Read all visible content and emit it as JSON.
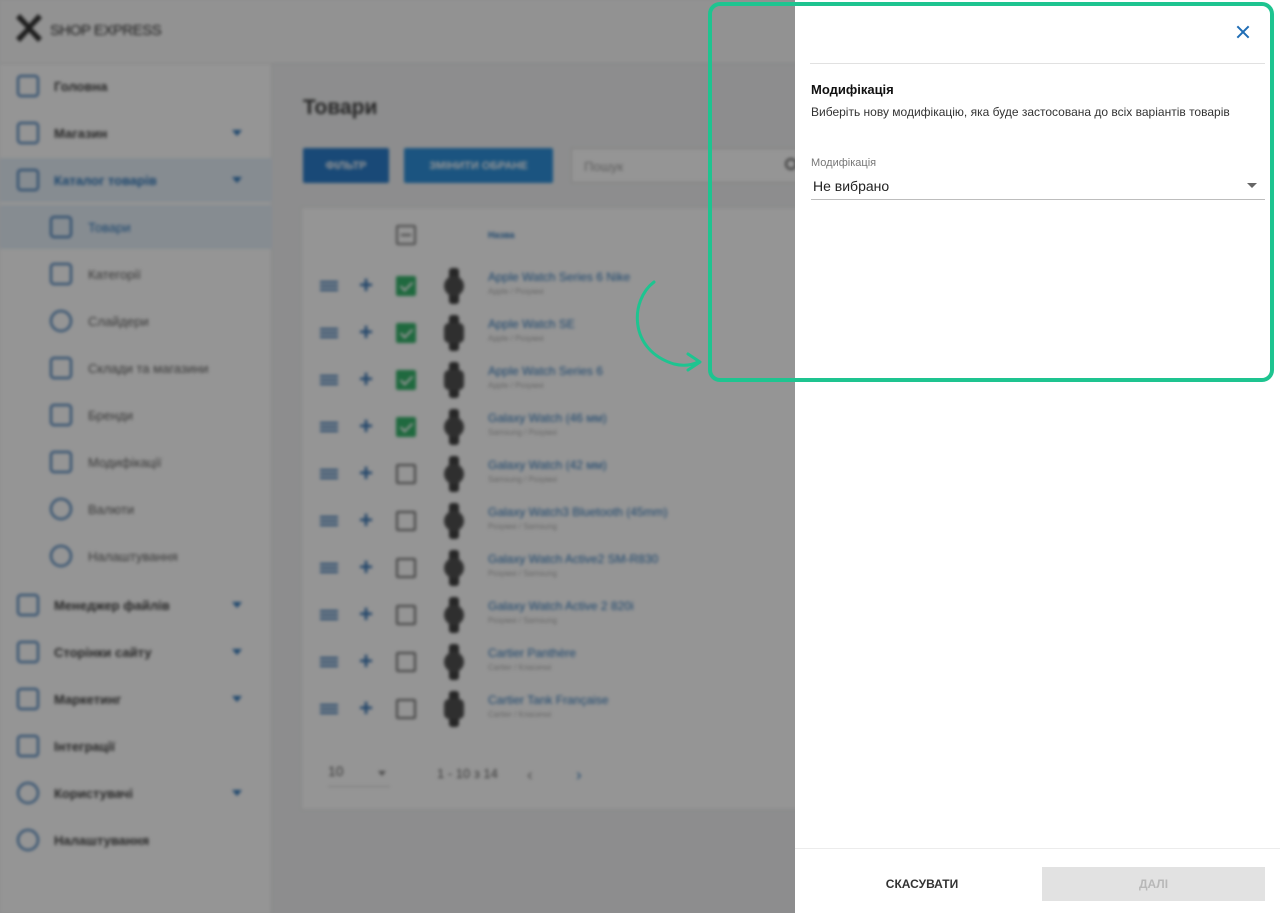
{
  "app": {
    "logo_text": "Shop Express"
  },
  "sidebar": {
    "items": [
      {
        "label": "Головна",
        "icon": "home-icon"
      },
      {
        "label": "Магазин",
        "icon": "cart-icon",
        "expandable": true
      },
      {
        "label": "Каталог товарів",
        "icon": "book-icon",
        "expandable": true,
        "active": true
      },
      {
        "label": "Товари",
        "icon": "box-icon",
        "sub": true,
        "active": true
      },
      {
        "label": "Категорії",
        "icon": "categories-icon",
        "sub": true
      },
      {
        "label": "Слайдери",
        "icon": "slider-icon",
        "sub": true
      },
      {
        "label": "Склади та магазини",
        "icon": "warehouse-icon",
        "sub": true
      },
      {
        "label": "Бренди",
        "icon": "tag-icon",
        "sub": true
      },
      {
        "label": "Модифікації",
        "icon": "bookmark-icon",
        "sub": true
      },
      {
        "label": "Валюти",
        "icon": "currency-icon",
        "sub": true
      },
      {
        "label": "Налаштування",
        "icon": "gear-icon",
        "sub": true
      },
      {
        "label": "Менеджер файлів",
        "icon": "folder-icon",
        "expandable": true
      },
      {
        "label": "Сторінки сайту",
        "icon": "pages-icon",
        "expandable": true
      },
      {
        "label": "Маркетинг",
        "icon": "marketing-icon",
        "expandable": true
      },
      {
        "label": "Інтеграції",
        "icon": "megaphone-icon"
      },
      {
        "label": "Користувачі",
        "icon": "users-icon",
        "expandable": true
      },
      {
        "label": "Налаштування",
        "icon": "gear-icon"
      }
    ]
  },
  "main": {
    "title": "Товари",
    "filter_button": "ФІЛЬТР",
    "change_button": "ЗМІНИТИ ОБРАНЕ",
    "search_placeholder": "Пошук",
    "column_name": "Назва",
    "rows": [
      {
        "name": "Apple Watch Series 6 Nike",
        "sub": "Apple / Розумні",
        "checked": true,
        "thumb": "round"
      },
      {
        "name": "Apple Watch SE",
        "sub": "Apple / Розумні",
        "checked": true,
        "thumb": "square"
      },
      {
        "name": "Apple Watch Series 6",
        "sub": "Apple / Розумні",
        "checked": true,
        "thumb": "square"
      },
      {
        "name": "Galaxy Watch (46 мм)",
        "sub": "Samsung / Розумні",
        "checked": true,
        "thumb": "round"
      },
      {
        "name": "Galaxy Watch (42 мм)",
        "sub": "Samsung / Розумні",
        "checked": false,
        "thumb": "round"
      },
      {
        "name": "Galaxy Watch3 Bluetooth (45mm)",
        "sub": "Розумні / Samsung",
        "checked": false,
        "thumb": "round"
      },
      {
        "name": "Galaxy Watch Active2 SM-R830",
        "sub": "Розумні / Samsung",
        "checked": false,
        "thumb": "round"
      },
      {
        "name": "Galaxy Watch Active 2 820i",
        "sub": "Розумні / Samsung",
        "checked": false,
        "thumb": "round"
      },
      {
        "name": "Cartier Panthère",
        "sub": "Cartier / Класичні",
        "checked": false,
        "thumb": "round"
      },
      {
        "name": "Cartier Tank Française",
        "sub": "Cartier / Класичні",
        "checked": false,
        "thumb": "square"
      }
    ],
    "page_size": "10",
    "range_text": "1 - 10 з 14",
    "prev_label": "‹",
    "next_label": "›"
  },
  "dialog": {
    "close_label": "×",
    "heading": "Модифікація",
    "description": "Виберіть нову модифікацію, яка буде застосована до всіх варіантів товарів",
    "select_label": "Модифікація",
    "select_value": "Не вибрано",
    "cancel_label": "СКАСУВАТИ",
    "next_label": "ДАЛІ"
  },
  "colors": {
    "accent": "#1f6db5",
    "highlight": "#1ec490",
    "checked": "#27ae60"
  }
}
